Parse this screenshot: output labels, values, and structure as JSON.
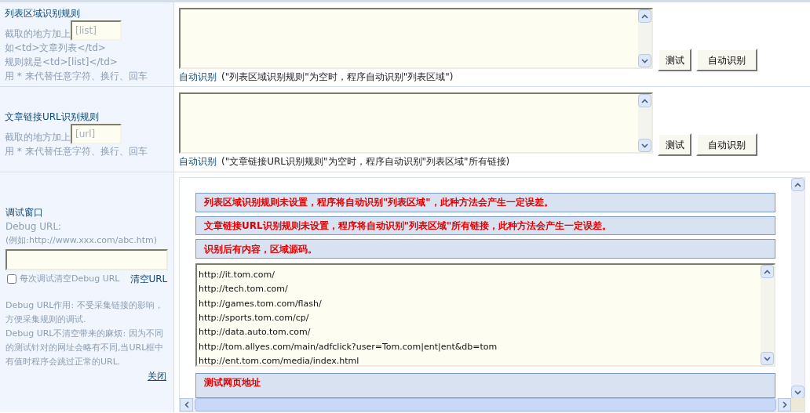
{
  "rules": [
    {
      "title": "列表区域识别规则",
      "hint_prefix": "截取的地方加上",
      "placeholder": "[list]",
      "notes": [
        "如<td>文章列表</td>",
        "规则就是<td>[list]</td>",
        "用 * 来代替任意字符、换行、回车"
      ],
      "auto_link": "自动识别",
      "auto_note": "(\"列表区域识别规则\"为空时，程序自动识别\"列表区域\")",
      "buttons": [
        "测试",
        "自动识别"
      ]
    },
    {
      "title": "文章链接URL识别规则",
      "hint_prefix": "截取的地方加上",
      "placeholder": "[url]",
      "notes": [
        "用 * 来代替任意字符、换行、回车"
      ],
      "auto_link": "自动识别",
      "auto_note": "(\"文章链接URL识别规则\"为空时，程序自动识别\"列表区域\"所有链接)",
      "buttons": [
        "测试",
        "自动识别"
      ]
    }
  ],
  "debug": {
    "title": "调试窗口",
    "url_label": "Debug URL:",
    "example": "(例如:http://www.xxx.com/abc.htm)",
    "checkbox": {
      "label": "每次调试清空Debug URL",
      "checked": false
    },
    "clear_link": "清空URL",
    "notes": [
      "Debug URL作用: 不受采集链接的影响，方便采集规则的调试.",
      "Debug URL不清空带来的麻烦: 因为不同的测试针对的网址会略有不同,当URL框中有值时程序会跳过正常的URL."
    ],
    "close_link": "关闭"
  },
  "messages": [
    "列表区域识别规则未设置，程序将自动识别\"列表区域\"，此种方法会产生一定误差。",
    "文章链接URL识别规则未设置，程序将自动识别\"列表区域\"所有链接，此种方法会产生一定误差。",
    "识别后有内容，区域源码。"
  ],
  "url_list": [
    "http://it.tom.com/",
    "http://tech.tom.com/",
    "http://games.tom.com/flash/",
    "http://sports.tom.com/cp/",
    "http://data.auto.tom.com/",
    "http://tom.allyes.com/main/adfclick?user=Tom.com|ent|ent&db=tom",
    "http://ent.tom.com/media/index.html"
  ],
  "last_message": "测试网页地址"
}
